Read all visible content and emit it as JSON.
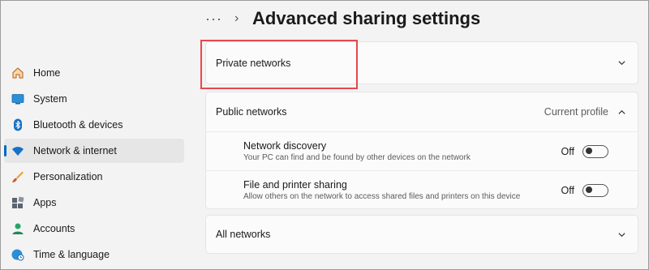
{
  "header": {
    "more_label": "···",
    "separator": "›",
    "title": "Advanced sharing settings"
  },
  "sidebar": {
    "items": [
      {
        "label": "Home",
        "icon": "home-icon"
      },
      {
        "label": "System",
        "icon": "monitor-icon"
      },
      {
        "label": "Bluetooth & devices",
        "icon": "bluetooth-icon"
      },
      {
        "label": "Network & internet",
        "icon": "wifi-icon",
        "selected": true
      },
      {
        "label": "Personalization",
        "icon": "brush-icon"
      },
      {
        "label": "Apps",
        "icon": "apps-icon"
      },
      {
        "label": "Accounts",
        "icon": "person-icon"
      },
      {
        "label": "Time & language",
        "icon": "globe-clock-icon"
      }
    ]
  },
  "private_networks": {
    "label": "Private networks",
    "expanded": false
  },
  "public_networks": {
    "label": "Public networks",
    "status": "Current profile",
    "expanded": true,
    "settings": [
      {
        "title": "Network discovery",
        "description": "Your PC can find and be found by other devices on the network",
        "state_label": "Off",
        "on": false
      },
      {
        "title": "File and printer sharing",
        "description": "Allow others on the network to access shared files and printers on this device",
        "state_label": "Off",
        "on": false
      }
    ]
  },
  "all_networks": {
    "label": "All networks",
    "expanded": false
  },
  "colors": {
    "accent": "#0067c0",
    "highlight": "#e8474c",
    "background": "#f3f3f3",
    "card": "#fbfbfb"
  }
}
